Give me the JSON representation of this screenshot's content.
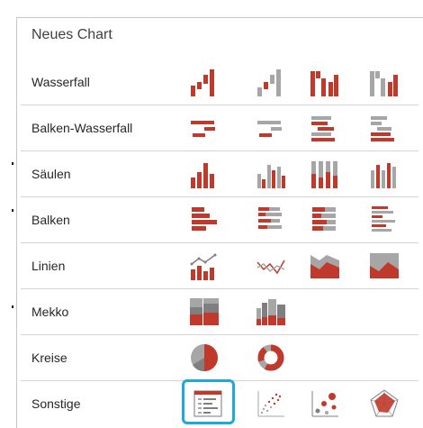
{
  "panel": {
    "title": "Neues Chart",
    "rows": [
      {
        "label": "Wasserfall",
        "icons": [
          "waterfall-icon",
          "waterfall-light-icon",
          "waterfall-bars-icon",
          "waterfall-bars-light-icon"
        ]
      },
      {
        "label": "Balken-Wasserfall",
        "icons": [
          "bar-waterfall-icon",
          "bar-waterfall-light-icon",
          "bar-waterfall-stacked-icon",
          "bar-waterfall-stacked-light-icon"
        ]
      },
      {
        "label": "Säulen",
        "icons": [
          "column-chart-icon",
          "clustered-column-chart-icon",
          "stacked-column-chart-icon",
          "percent-column-chart-icon"
        ]
      },
      {
        "label": "Balken",
        "icons": [
          "bar-chart-icon",
          "clustered-bar-chart-icon",
          "stacked-bar-chart-icon",
          "percent-bar-chart-icon"
        ]
      },
      {
        "label": "Linien",
        "icons": [
          "line-column-chart-icon",
          "line-chart-icon",
          "area-chart-icon",
          "stacked-area-chart-icon"
        ]
      },
      {
        "label": "Mekko",
        "icons": [
          "mekko-chart-icon",
          "mekko-bar-chart-icon"
        ]
      },
      {
        "label": "Kreise",
        "icons": [
          "pie-chart-icon",
          "doughnut-chart-icon"
        ]
      },
      {
        "label": "Sonstige",
        "icons": [
          "table-chart-icon",
          "scatter-chart-icon",
          "bubble-chart-icon",
          "radar-chart-icon"
        ]
      }
    ],
    "selected_icon": "table-chart-icon"
  },
  "colors": {
    "accent_red": "#c0392b",
    "gray": "#a6a6a6",
    "dark_gray": "#7f7f7f",
    "selection": "#1fa8d8",
    "separator": "#d4d4d4"
  }
}
